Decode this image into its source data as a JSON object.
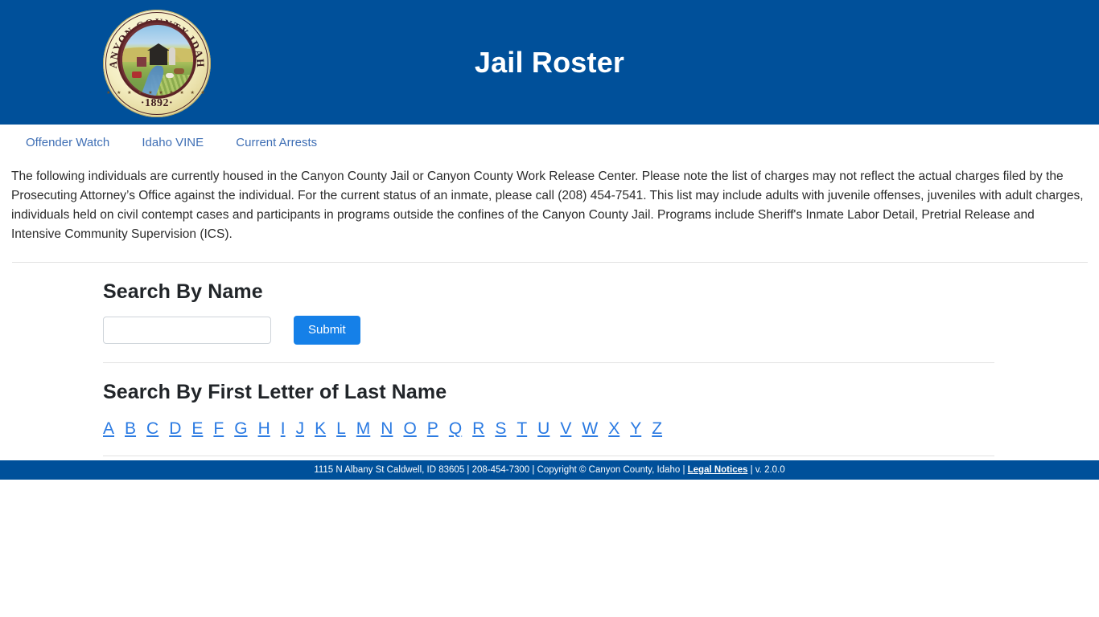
{
  "header": {
    "title": "Jail Roster",
    "seal": {
      "top_text": "CANYON COUNTY IDAHO",
      "year": "·1892·",
      "stars": "★ ★ ★ ★ ★      ★ ★ ★ ★ ★"
    },
    "background_color": "#00509A"
  },
  "nav": {
    "links": [
      {
        "label": "Offender Watch"
      },
      {
        "label": "Idaho VINE"
      },
      {
        "label": "Current Arrests"
      }
    ],
    "link_color": "#3f6fb5"
  },
  "intro": {
    "text": "The following individuals are currently housed in the Canyon County Jail or Canyon County Work Release Center. Please note the list of charges may not reflect the actual charges filed by the Prosecuting Attorney’s Office against the individual. For the current status of an inmate, please call (208) 454-7541. This list may include adults with juvenile offenses, juveniles with adult charges, individuals held on civil contempt cases and participants in programs outside the confines of the Canyon County Jail. Programs include Sheriff's Inmate Labor Detail, Pretrial Release and Intensive Community Supervision (ICS)."
  },
  "search_by_name": {
    "heading": "Search By Name",
    "input_value": "",
    "input_placeholder": "",
    "submit_label": "Submit",
    "submit_color": "#1580E8"
  },
  "search_by_letter": {
    "heading": "Search By First Letter of Last Name",
    "letters": [
      "A",
      "B",
      "C",
      "D",
      "E",
      "F",
      "G",
      "H",
      "I",
      "J",
      "K",
      "L",
      "M",
      "N",
      "O",
      "P",
      "Q",
      "R",
      "S",
      "T",
      "U",
      "V",
      "W",
      "X",
      "Y",
      "Z"
    ],
    "link_color": "#2a7ae2"
  },
  "footer": {
    "address": "1115 N Albany St Caldwell, ID 83605 | 208-454-7300 | Copyright © Canyon County, Idaho | ",
    "legal_label": "Legal Notices",
    "version": " | v. 2.0.0",
    "background_color": "#00509A"
  }
}
